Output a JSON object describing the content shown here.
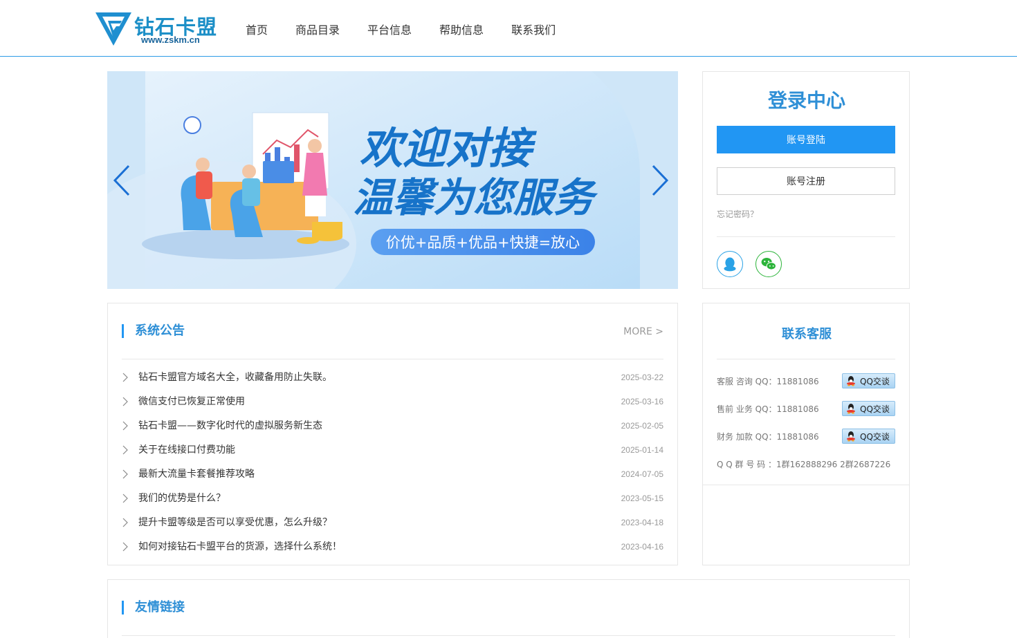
{
  "header": {
    "logo_text": "钻石卡盟",
    "logo_url": "www.zskm.cn",
    "nav": [
      "首页",
      "商品目录",
      "平台信息",
      "帮助信息",
      "联系我们"
    ]
  },
  "banner": {
    "headline_1": "欢迎对接",
    "headline_2": "温馨为您服务",
    "slogan": "价优+品质+优品+快捷=放心"
  },
  "login": {
    "title": "登录中心",
    "login_label": "账号登陆",
    "register_label": "账号注册",
    "forgot_label": "忘记密码？"
  },
  "notice": {
    "title": "系统公告",
    "more_label": "MORE >",
    "items": [
      {
        "title": "钻石卡盟官方域名大全，收藏备用防止失联。",
        "date": "2025-03-22"
      },
      {
        "title": "微信支付已恢复正常使用",
        "date": "2025-03-16"
      },
      {
        "title": "钻石卡盟——数字化时代的虚拟服务新生态",
        "date": "2025-02-05"
      },
      {
        "title": "关于在线接口付费功能",
        "date": "2025-01-14"
      },
      {
        "title": "最新大流量卡套餐推荐攻略",
        "date": "2024-07-05"
      },
      {
        "title": "我们的优势是什么？",
        "date": "2023-05-15"
      },
      {
        "title": "提升卡盟等级是否可以享受优惠，怎么升级？",
        "date": "2023-04-18"
      },
      {
        "title": "如何对接钻石卡盟平台的货源，选择什么系统！",
        "date": "2023-04-16"
      }
    ]
  },
  "contact": {
    "title": "联系客服",
    "rows": [
      {
        "text": "客服 咨询 QQ：11881086",
        "button": "QQ交谈"
      },
      {
        "text": "售前 业务 QQ：11881086",
        "button": "QQ交谈"
      },
      {
        "text": "财务 加款 QQ：11881086",
        "button": "QQ交谈"
      },
      {
        "text": "Q Q 群 号 码  ：1群162888296 2群2687226"
      }
    ]
  },
  "links": {
    "title": "友情链接"
  },
  "colors": {
    "accent": "#2196f3",
    "title_blue": "#2e8fd6"
  }
}
